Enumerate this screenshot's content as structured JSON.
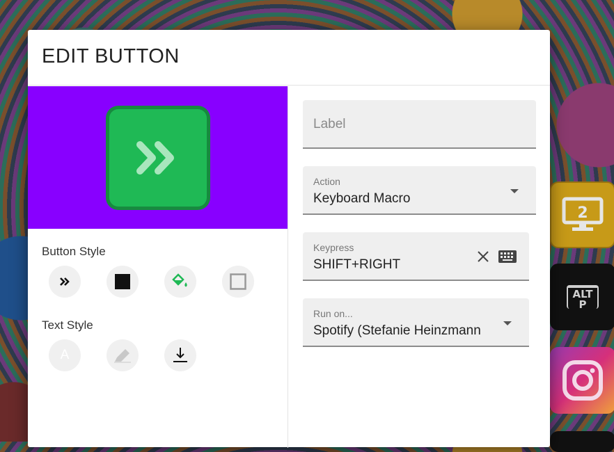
{
  "dialog": {
    "title": "EDIT BUTTON"
  },
  "preview": {
    "background_color": "#8800ff",
    "button_color": "#1fb955",
    "icon": "chevrons-right-icon"
  },
  "button_style": {
    "label": "Button Style",
    "options": [
      "chevrons-right-icon",
      "square-fill-icon",
      "paint-bucket-icon",
      "square-outline-icon"
    ]
  },
  "text_style": {
    "label": "Text Style",
    "options": [
      "text-color-icon",
      "pencil-icon",
      "download-icon"
    ],
    "text_color_glyph": "A"
  },
  "form": {
    "label_field": {
      "placeholder": "Label",
      "value": ""
    },
    "action_field": {
      "caption": "Action",
      "value": "Keyboard Macro"
    },
    "keypress_field": {
      "caption": "Keypress",
      "value": "SHIFT+RIGHT"
    },
    "run_on_field": {
      "caption": "Run on...",
      "value": "Spotify (Stefanie Heinzmann"
    }
  },
  "deck": {
    "tile_screen_number": "2",
    "tile_altp_line1": "ALT",
    "tile_altp_line2": "P",
    "colors": {
      "screen": "#c79a18",
      "altp": "#111111"
    }
  }
}
